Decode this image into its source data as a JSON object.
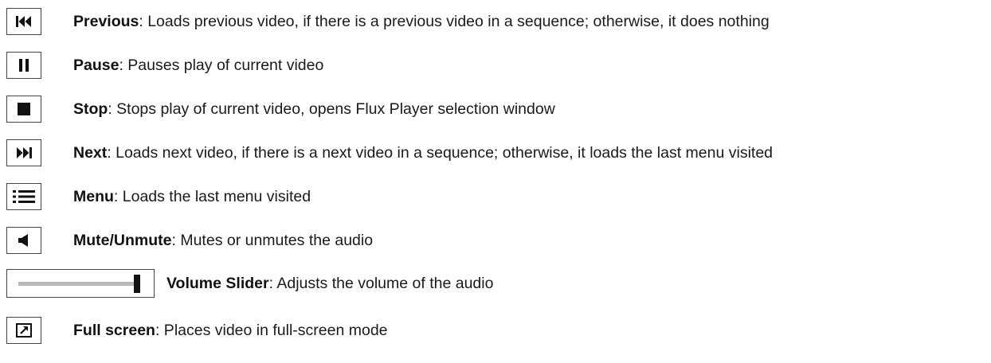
{
  "controls": [
    {
      "name": "Previous",
      "sep": ":",
      "text": " Loads previous video, if there is a previous video in a sequence; otherwise, it does nothing",
      "icon": "previous-icon"
    },
    {
      "name": "Pause",
      "sep": ":",
      "text": " Pauses play of current video",
      "icon": "pause-icon"
    },
    {
      "name": "Stop",
      "sep": ":",
      "text": " Stops play of current video, opens Flux Player selection window",
      "icon": "stop-icon"
    },
    {
      "name": "Next",
      "sep": ":",
      "text": " Loads next video, if there is a next video in a sequence; otherwise, it loads the last menu visited",
      "icon": "next-icon"
    },
    {
      "name": "Menu",
      "sep": ":",
      "text": " Loads the last menu visited",
      "icon": "menu-icon"
    },
    {
      "name": "Mute/Unmute",
      "sep": ":",
      "text": " Mutes or unmutes the audio",
      "icon": "speaker-icon"
    },
    {
      "name": "Volume Slider",
      "sep": ":",
      "text": " Adjusts the volume of the audio",
      "icon": "volume-slider-icon",
      "level": 1.0
    },
    {
      "name": "Full screen",
      "sep": ":",
      "text": " Places video in full-screen mode",
      "icon": "fullscreen-icon"
    }
  ],
  "colors": {
    "text": "#1a1a1a",
    "border": "#444444",
    "icon": "#111111",
    "slider_track": "#b9b9b9"
  }
}
